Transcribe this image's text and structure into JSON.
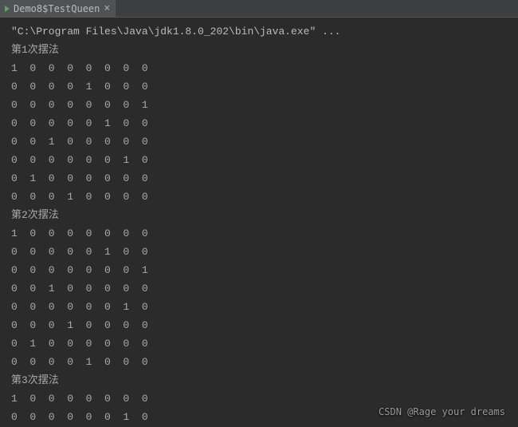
{
  "tab": {
    "title": "Demo8$TestQueen"
  },
  "command": "\"C:\\Program Files\\Java\\jdk1.8.0_202\\bin\\java.exe\" ...",
  "solutions": [
    {
      "label": "第1次摆法",
      "rows": [
        "1  0  0  0  0  0  0  0",
        "0  0  0  0  1  0  0  0",
        "0  0  0  0  0  0  0  1",
        "0  0  0  0  0  1  0  0",
        "0  0  1  0  0  0  0  0",
        "0  0  0  0  0  0  1  0",
        "0  1  0  0  0  0  0  0",
        "0  0  0  1  0  0  0  0"
      ]
    },
    {
      "label": "第2次摆法",
      "rows": [
        "1  0  0  0  0  0  0  0",
        "0  0  0  0  0  1  0  0",
        "0  0  0  0  0  0  0  1",
        "0  0  1  0  0  0  0  0",
        "0  0  0  0  0  0  1  0",
        "0  0  0  1  0  0  0  0",
        "0  1  0  0  0  0  0  0",
        "0  0  0  0  1  0  0  0"
      ]
    },
    {
      "label": "第3次摆法",
      "rows": [
        "1  0  0  0  0  0  0  0",
        "0  0  0  0  0  0  1  0"
      ]
    }
  ],
  "watermark": "CSDN @Rage your dreams"
}
